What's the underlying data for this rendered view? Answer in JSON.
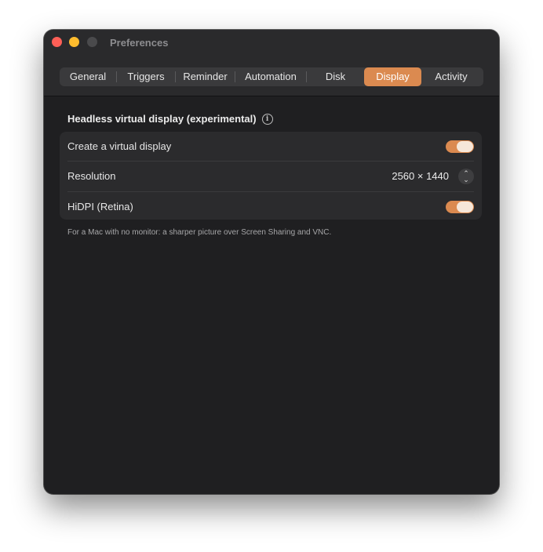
{
  "window": {
    "title": "Preferences"
  },
  "tabs": [
    {
      "label": "General"
    },
    {
      "label": "Triggers"
    },
    {
      "label": "Reminder"
    },
    {
      "label": "Automation"
    },
    {
      "label": "Disk"
    },
    {
      "label": "Display"
    },
    {
      "label": "Activity"
    }
  ],
  "active_tab": "Display",
  "display": {
    "section_title": "Headless virtual display (experimental)",
    "create_label": "Create a virtual display",
    "create_enabled": true,
    "resolution_label": "Resolution",
    "resolution_value": "2560 × 1440",
    "hidpi_label": "HiDPI (Retina)",
    "hidpi_enabled": true,
    "footnote": "For a Mac with no monitor: a sharper picture over Screen Sharing and VNC."
  },
  "colors": {
    "accent": "#db8a50",
    "window_bg": "#1f1f21",
    "close": "#fe5f57",
    "minimize": "#febc2e"
  },
  "icons": {
    "info": "info-circle-icon",
    "stepper": "up-down-chevron-icon"
  }
}
